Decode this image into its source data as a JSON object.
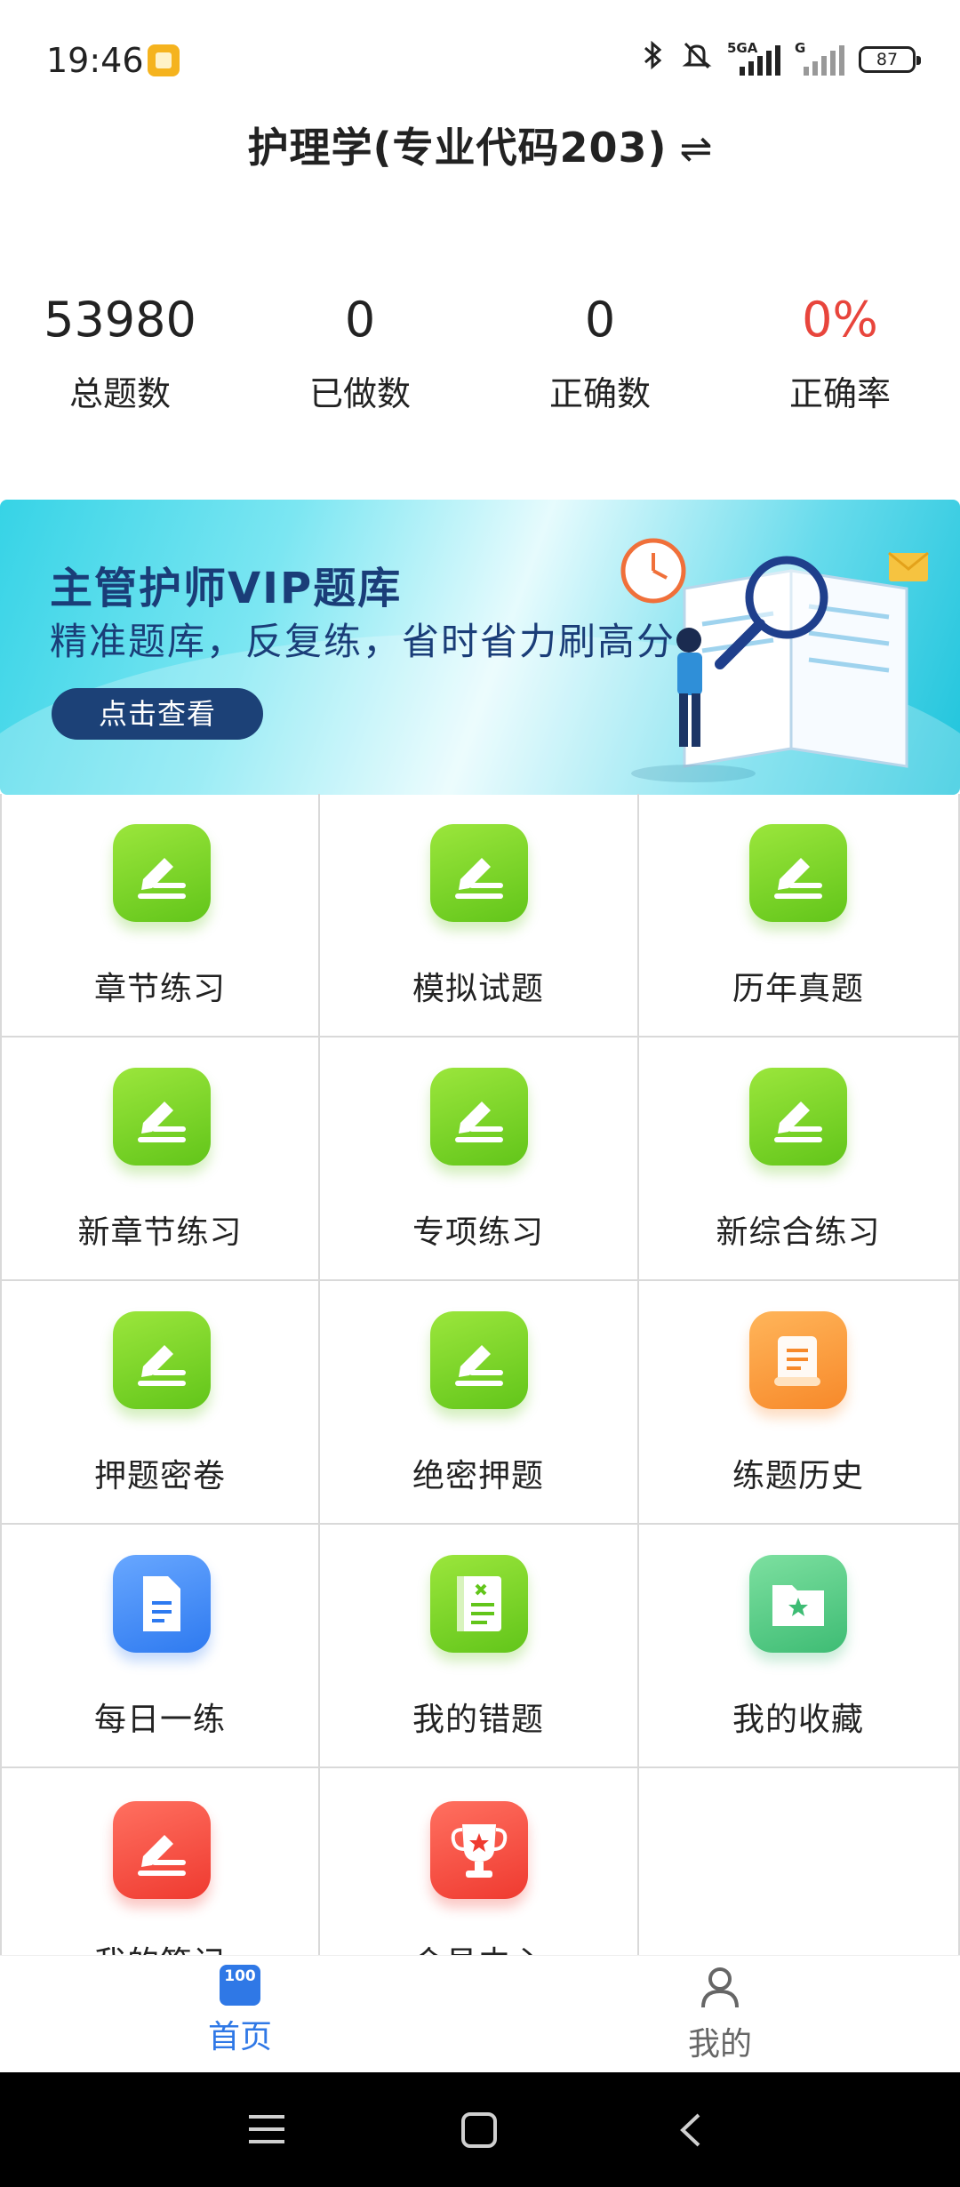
{
  "status_bar": {
    "time": "19:46",
    "network_label": "5GA",
    "network_label_2": "G",
    "battery": "87",
    "icons": [
      "bluetooth-icon",
      "mute-icon",
      "signal-icon",
      "signal-icon-2",
      "battery-icon"
    ]
  },
  "header": {
    "title": "护理学(专业代码203)",
    "switch_icon": "swap-icon"
  },
  "stats": [
    {
      "value": "53980",
      "label": "总题数"
    },
    {
      "value": "0",
      "label": "已做数"
    },
    {
      "value": "0",
      "label": "正确数"
    },
    {
      "value": "0%",
      "label": "正确率"
    }
  ],
  "banner": {
    "title": "主管护师VIP题库",
    "subtitle": "精准题库，反复练，省时省力刷高分",
    "button": "点击查看"
  },
  "grid": [
    {
      "label": "章节练习",
      "icon": "edit-icon",
      "color": "green"
    },
    {
      "label": "模拟试题",
      "icon": "edit-icon",
      "color": "green"
    },
    {
      "label": "历年真题",
      "icon": "edit-icon",
      "color": "green"
    },
    {
      "label": "新章节练习",
      "icon": "edit-icon",
      "color": "green"
    },
    {
      "label": "专项练习",
      "icon": "edit-icon",
      "color": "green"
    },
    {
      "label": "新综合练习",
      "icon": "edit-icon",
      "color": "green"
    },
    {
      "label": "押题密卷",
      "icon": "edit-icon",
      "color": "green"
    },
    {
      "label": "绝密押题",
      "icon": "edit-icon",
      "color": "green"
    },
    {
      "label": "练题历史",
      "icon": "scroll-icon",
      "color": "orange"
    },
    {
      "label": "每日一练",
      "icon": "document-icon",
      "color": "blue"
    },
    {
      "label": "我的错题",
      "icon": "wrong-book-icon",
      "color": "green"
    },
    {
      "label": "我的收藏",
      "icon": "star-folder-icon",
      "color": "teal"
    },
    {
      "label": "我的笔记",
      "icon": "edit-icon",
      "color": "red"
    },
    {
      "label": "会员中心",
      "icon": "trophy-icon",
      "color": "red"
    }
  ],
  "bottom_nav": {
    "home": {
      "label": "首页",
      "icon_text": "100"
    },
    "mine": {
      "label": "我的"
    }
  },
  "colors": {
    "accent": "#2f78e6",
    "rate_red": "#e8453c",
    "banner_text": "#1a3d78",
    "green_tile": "#7ad42a"
  }
}
